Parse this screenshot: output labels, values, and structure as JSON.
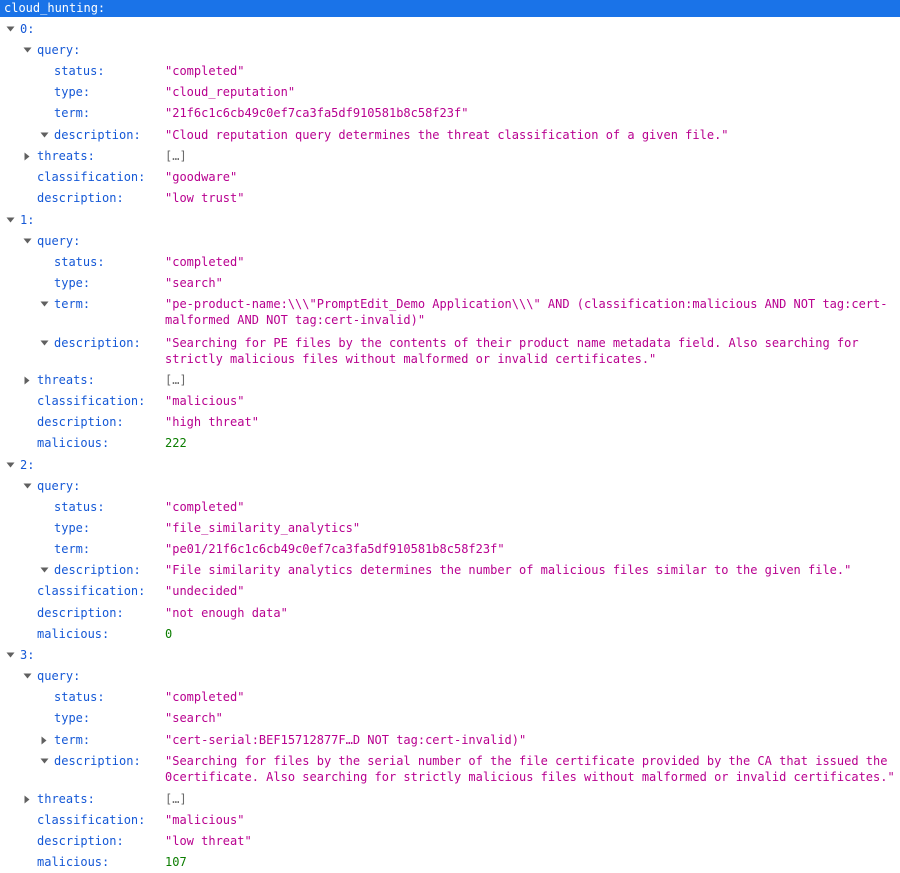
{
  "title": "cloud_hunting:",
  "items": [
    {
      "index_label": "0:",
      "query_label": "query:",
      "status_label": "status:",
      "status": "\"completed\"",
      "type_label": "type:",
      "type": "\"cloud_reputation\"",
      "term_label": "term:",
      "term": "\"21f6c1c6cb49c0ef7ca3fa5df910581b8c58f23f\"",
      "qdesc_label": "description:",
      "qdesc": "\"Cloud reputation query determines the threat classification of a given file.\"",
      "threats_label": "threats:",
      "threats": "[…]",
      "classification_label": "classification:",
      "classification": "\"goodware\"",
      "description_label": "description:",
      "description": "\"low trust\""
    },
    {
      "index_label": "1:",
      "query_label": "query:",
      "status_label": "status:",
      "status": "\"completed\"",
      "type_label": "type:",
      "type": "\"search\"",
      "term_label": "term:",
      "term": "\"pe-product-name:\\\\\\\"PromptEdit_Demo Application\\\\\\\" AND (classification:malicious AND NOT tag:cert-malformed AND NOT tag:cert-invalid)\"",
      "qdesc_label": "description:",
      "qdesc": "\"Searching for PE files by the contents of their product name metadata field. Also searching for strictly malicious files without malformed or invalid certificates.\"",
      "threats_label": "threats:",
      "threats": "[…]",
      "classification_label": "classification:",
      "classification": "\"malicious\"",
      "description_label": "description:",
      "description": "\"high threat\"",
      "malicious_label": "malicious:",
      "malicious": "222"
    },
    {
      "index_label": "2:",
      "query_label": "query:",
      "status_label": "status:",
      "status": "\"completed\"",
      "type_label": "type:",
      "type": "\"file_similarity_analytics\"",
      "term_label": "term:",
      "term": "\"pe01/21f6c1c6cb49c0ef7ca3fa5df910581b8c58f23f\"",
      "qdesc_label": "description:",
      "qdesc": "\"File similarity analytics determines the number of malicious files similar to the given file.\"",
      "classification_label": "classification:",
      "classification": "\"undecided\"",
      "description_label": "description:",
      "description": "\"not enough data\"",
      "malicious_label": "malicious:",
      "malicious": "0"
    },
    {
      "index_label": "3:",
      "query_label": "query:",
      "status_label": "status:",
      "status": "\"completed\"",
      "type_label": "type:",
      "type": "\"search\"",
      "term_label": "term:",
      "term": "\"cert-serial:BEF15712877F…D NOT tag:cert-invalid)\"",
      "qdesc_label": "description:",
      "qdesc": "\"Searching for files by the serial number of the file certificate provided by the CA that issued the 0certificate. Also searching for strictly malicious files without malformed or invalid certificates.\"",
      "threats_label": "threats:",
      "threats": "[…]",
      "classification_label": "classification:",
      "classification": "\"malicious\"",
      "description_label": "description:",
      "description": "\"low threat\"",
      "malicious_label": "malicious:",
      "malicious": "107"
    }
  ]
}
